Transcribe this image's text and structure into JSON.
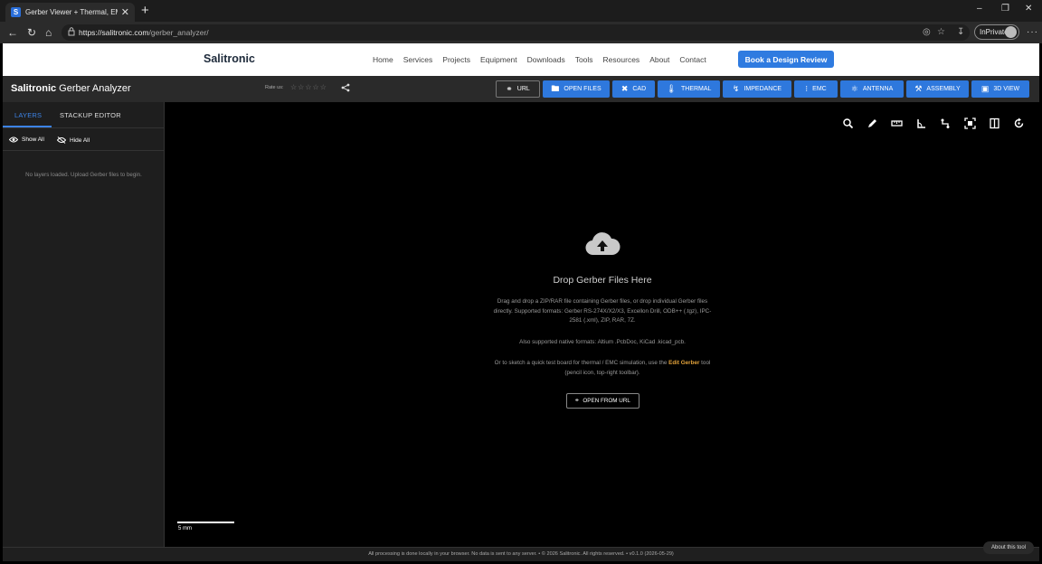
{
  "browser": {
    "tab_title": "Gerber Viewer + Thermal, EMI & I…",
    "tab_close": "✕",
    "new_tab": "+",
    "url_host": "https://salitronic.com",
    "url_path": "/gerber_analyzer/",
    "inprivate": "InPrivate",
    "minimize": "–",
    "restore": "❐",
    "close": "✕",
    "more": "···"
  },
  "site": {
    "brand": "Salitronic",
    "nav": [
      "Home",
      "Services",
      "Projects",
      "Equipment",
      "Downloads",
      "Tools",
      "Resources",
      "About",
      "Contact"
    ],
    "cta": "Book a Design Review"
  },
  "app": {
    "title_bold": "Salitronic",
    "title_rest": " Gerber Analyzer",
    "rate_label": "Rate us:",
    "stars": "☆☆☆☆☆",
    "buttons": {
      "url": "URL",
      "open_files": "OPEN FILES",
      "cad": "CAD",
      "thermal": "THERMAL",
      "impedance": "IMPEDANCE",
      "emc": "EMC",
      "antenna": "ANTENNA",
      "assembly": "ASSEMBLY",
      "view3d": "3D VIEW"
    }
  },
  "sidebar": {
    "tab_layers": "LAYERS",
    "tab_stackup": "STACKUP EDITOR",
    "show_all": "Show All",
    "hide_all": "Hide All",
    "empty": "No layers loaded. Upload Gerber files to begin."
  },
  "canvas": {
    "drop_title": "Drop Gerber Files Here",
    "drop_desc": "Drag and drop a ZIP/RAR file containing Gerber files, or drop individual Gerber files directly. Supported formats: Gerber RS-274X/X2/X3, Excellon Drill, ODB++ (.tgz), IPC-2581 (.xml), ZIP, RAR, 7Z.",
    "native": "Also supported native formats: Altium .PcbDoc, KiCad .kicad_pcb.",
    "sketch_pre": "Or to sketch a quick test board for thermal / EMC simulation, use the ",
    "sketch_link": "Edit Gerber",
    "sketch_post": " tool (pencil icon, top-right toolbar).",
    "open_url": "OPEN FROM URL",
    "scale": "5 mm"
  },
  "footer": {
    "text": "All processing is done locally in your browser. No data is sent to any server. • © 2026 Salitronic. All rights reserved. • v0.1.0 (2026-05-29)",
    "about": "About this tool"
  }
}
